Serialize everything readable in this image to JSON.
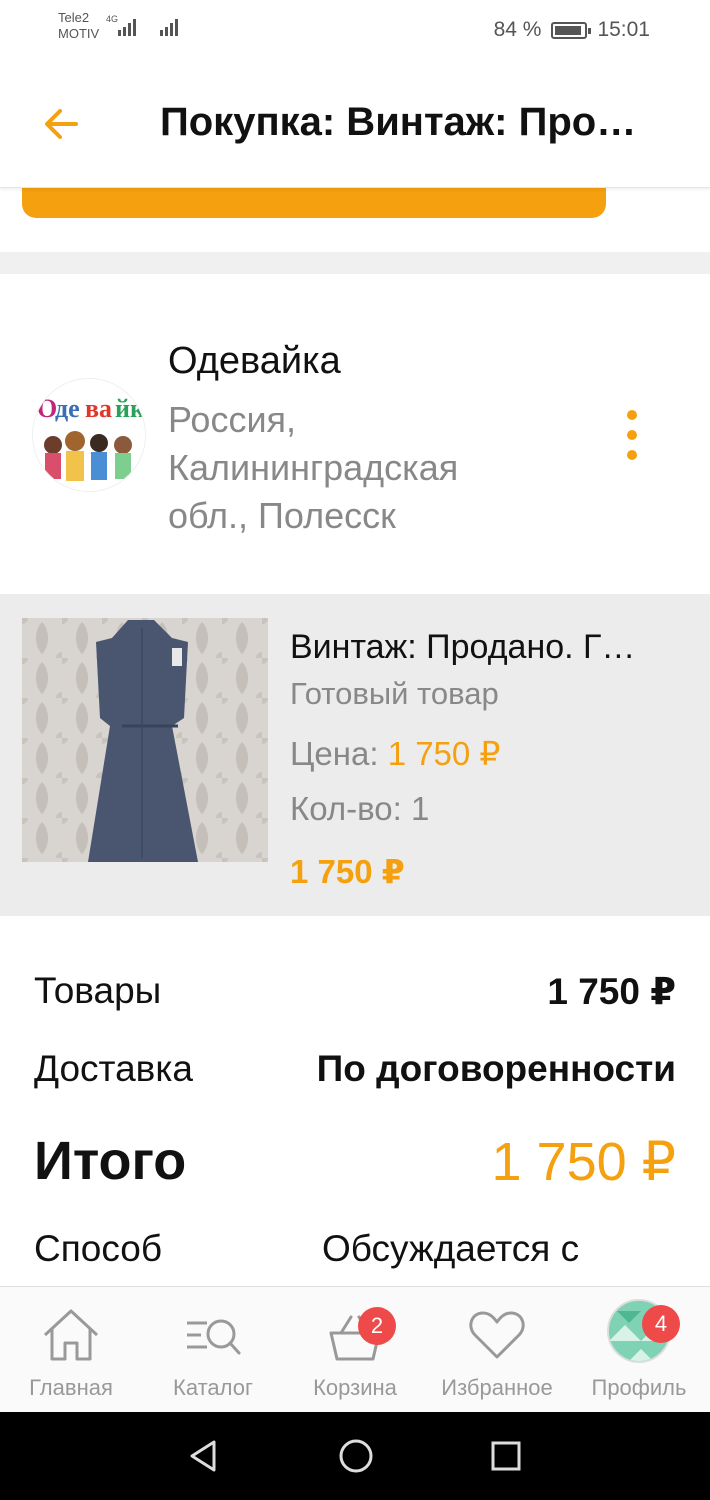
{
  "status_bar": {
    "carrier_top": "Tele2",
    "carrier_bottom": "MOTIV",
    "network": "4G",
    "battery": "84 %",
    "time": "15:01"
  },
  "appbar": {
    "back_icon": "arrow-left-icon",
    "title": "Покупка: Винтаж: Про…"
  },
  "seller": {
    "name": "Одевайка",
    "location": "Россия, Калининградская обл., Полесск",
    "avatar_text": "Одевайк"
  },
  "product": {
    "title": "Винтаж: Продано. Г…",
    "type": "Готовый товар",
    "price_label": "Цена:",
    "price_value": "1 750 ₽",
    "qty_label": "Кол-во:",
    "qty_value": "1",
    "total": "1 750 ₽"
  },
  "summary": {
    "goods_label": "Товары",
    "goods_value": "1 750 ₽",
    "delivery_label": "Доставка",
    "delivery_value": "По договоренности",
    "total_label": "Итого",
    "total_value": "1 750 ₽",
    "method_label": "Способ",
    "method_value": "Обсуждается с"
  },
  "bottom_nav": {
    "items": [
      {
        "label": "Главная",
        "icon": "home-icon"
      },
      {
        "label": "Каталог",
        "icon": "catalog-search-icon"
      },
      {
        "label": "Корзина",
        "icon": "basket-icon",
        "badge": "2"
      },
      {
        "label": "Избранное",
        "icon": "heart-icon"
      },
      {
        "label": "Профиль",
        "icon": "profile-avatar",
        "badge": "4"
      }
    ]
  },
  "colors": {
    "accent": "#f5a00f",
    "badge": "#ee4a4a",
    "muted_text": "#888888"
  }
}
